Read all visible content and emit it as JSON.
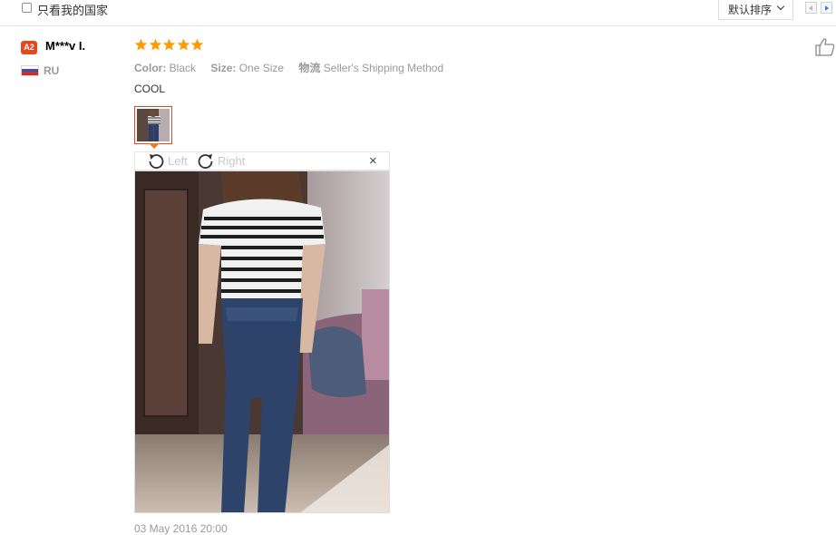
{
  "filter": {
    "own_country_label": "只看我的国家",
    "checked": false
  },
  "sort": {
    "label": "默认排序"
  },
  "review": {
    "level_badge": "A2",
    "username": "M***v I.",
    "country": "RU",
    "rating": 5,
    "attributes": [
      {
        "key": "Color:",
        "value": "Black"
      },
      {
        "key": "Size:",
        "value": "One Size"
      },
      {
        "key": "物流",
        "value": "Seller's Shipping Method"
      }
    ],
    "text": "COOL",
    "date": "03 May 2016 20:00"
  },
  "viewer": {
    "rotate_left_label": "Left",
    "rotate_right_label": "Right",
    "close_glyph": "×"
  },
  "colors": {
    "accent": "#e8461f",
    "star": "#ff9a00",
    "muted_text": "#999999"
  },
  "icons": [
    "checkbox-icon",
    "chevron-down-icon",
    "pager-prev-icon",
    "pager-next-icon",
    "star-icon",
    "russia-flag-icon",
    "rotate-left-icon",
    "rotate-right-icon",
    "close-icon",
    "thumbs-up-icon"
  ]
}
